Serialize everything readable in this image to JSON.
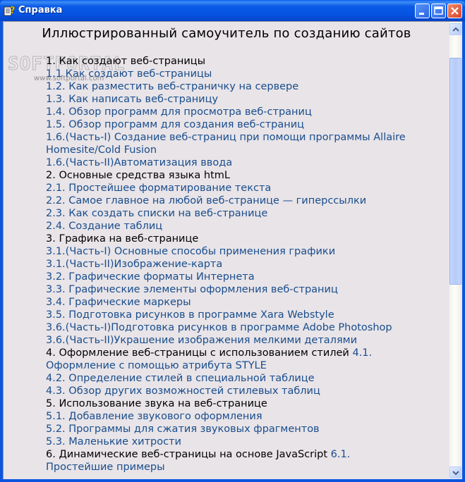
{
  "window": {
    "title": "Справка",
    "icon": "help-file-icon",
    "buttons": {
      "minimize": "minimize-icon",
      "maximize": "maximize-icon",
      "close": "close-icon"
    }
  },
  "watermark": {
    "logo": "SOFTPORTAL",
    "url": "www.softportal.com"
  },
  "page": {
    "title": "Иллюстрированный самоучитель по созданию сайтов"
  },
  "toc": [
    {
      "type": "section",
      "text": "1. Как создают веб-страницы"
    },
    {
      "type": "link",
      "text": "1.1 Как создают веб-страницы"
    },
    {
      "type": "link",
      "text": "1.2. Как разместить веб-страничку на сервере"
    },
    {
      "type": "link",
      "text": "1.3. Как написать веб-страницу"
    },
    {
      "type": "link",
      "text": "1.4. Обзор программ для просмотра веб-страниц"
    },
    {
      "type": "link",
      "text": "1.5. Обзор программ для создания веб-страниц"
    },
    {
      "type": "link",
      "text": "1.6.(Часть-I) Создание веб-страниц при помощи программы Allaire Homesite/Cold Fusion"
    },
    {
      "type": "link",
      "text": "1.6.(Часть-II)Автоматизация ввода"
    },
    {
      "type": "section",
      "text": "2. Основные средства языка htmL"
    },
    {
      "type": "link",
      "text": "2.1. Простейшее форматирование текста"
    },
    {
      "type": "link",
      "text": "2.2. Самое главное на любой веб-странице — гиперссылки"
    },
    {
      "type": "link",
      "text": "2.3. Как создать списки на веб-странице"
    },
    {
      "type": "link",
      "text": "2.4. Создание таблиц"
    },
    {
      "type": "section",
      "text": "3. Графика на веб-странице"
    },
    {
      "type": "link",
      "text": "3.1.(Часть-I) Основные способы применения графики"
    },
    {
      "type": "link",
      "text": "3.1.(Часть-II)Изображение-карта"
    },
    {
      "type": "link",
      "text": "3.2. Графические форматы Интернета"
    },
    {
      "type": "link",
      "text": "3.3. Графические элементы оформления веб-страниц"
    },
    {
      "type": "link",
      "text": "3.4. Графические маркеры"
    },
    {
      "type": "link",
      "text": "3.5. Подготовка рисунков в программе Xara Webstyle"
    },
    {
      "type": "link",
      "text": "3.6.(Часть-I)Подготовка рисунков в программе Adobe Photoshop"
    },
    {
      "type": "link",
      "text": "3.6.(Часть-II)Украшение изображения мелкими деталями"
    },
    {
      "type": "section",
      "text": "4. Оформление веб-страницы с использованием стилей",
      "inline_link": "4.1. Оформление с помощью атрибута STYLE"
    },
    {
      "type": "link",
      "text": "4.2. Определение стилей в специальной таблице"
    },
    {
      "type": "link",
      "text": "4.3. Обзор других возможностей стилевых таблиц"
    },
    {
      "type": "section",
      "text": "5. Использование звука на веб-странице"
    },
    {
      "type": "link",
      "text": "5.1. Добавление звукового оформления"
    },
    {
      "type": "link",
      "text": "5.2. Программы для сжатия звуковых фрагментов"
    },
    {
      "type": "link",
      "text": "5.3. Маленькие хитрости"
    },
    {
      "type": "section",
      "text": "6. Динамические веб-страницы на основе JavaScript",
      "inline_link": "6.1. Простейшие примеры"
    }
  ],
  "scrollbar": {
    "position_fraction": 0.05,
    "visible_fraction": 0.53
  },
  "colors": {
    "titlebar": "#0a5ae8",
    "background": "#e8e4e8",
    "link": "#1a4d8c",
    "section": "#000000"
  }
}
